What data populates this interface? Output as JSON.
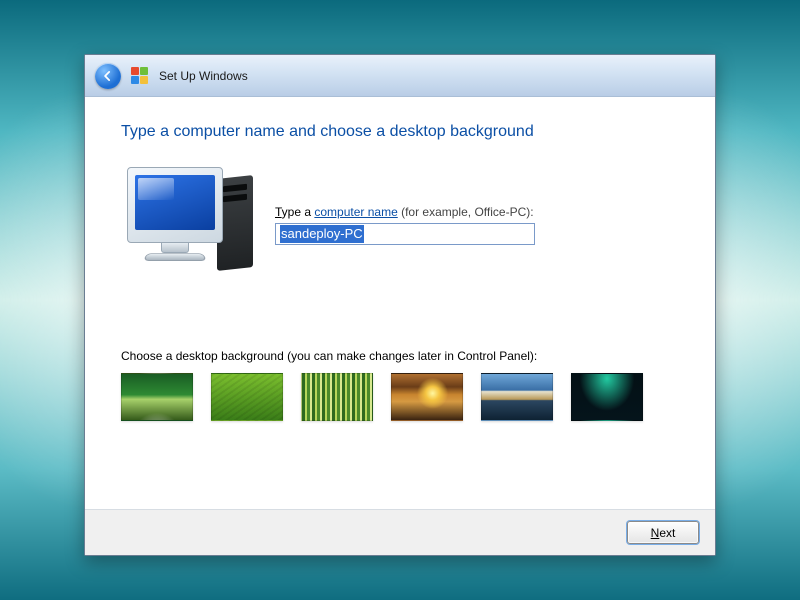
{
  "titlebar": {
    "title": "Set Up Windows"
  },
  "heading": "Type a computer name and choose a desktop background",
  "computer_name": {
    "label_prefix": "T",
    "label_text": "ype a ",
    "label_link": "computer name",
    "label_hint": " (for example, Office-PC):",
    "value": "sandeploy-PC"
  },
  "background": {
    "label": "Choose a desktop background (you can make changes later in Control Panel):",
    "thumbs": [
      {
        "name": "wallpaper-vista-aurora"
      },
      {
        "name": "wallpaper-leaf"
      },
      {
        "name": "wallpaper-bamboo"
      },
      {
        "name": "wallpaper-sunset-field"
      },
      {
        "name": "wallpaper-mountain-lake"
      },
      {
        "name": "wallpaper-northern-lights"
      }
    ]
  },
  "buttons": {
    "next_u": "N",
    "next_rest": "ext"
  }
}
